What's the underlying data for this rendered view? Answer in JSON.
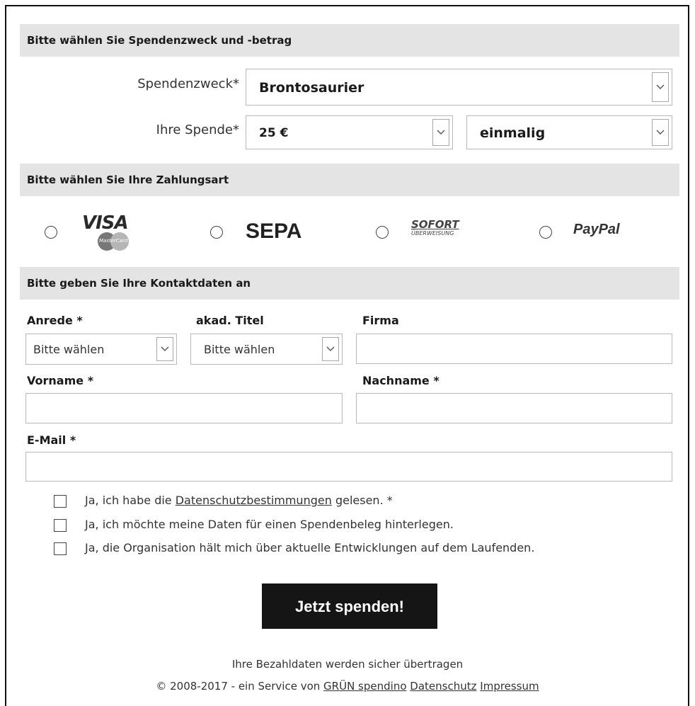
{
  "section1": {
    "title": "Bitte wählen Sie Spendenzweck und -betrag",
    "purpose_label": "Spendenzweck",
    "purpose_value": "Brontosaurier",
    "amount_label": "Ihre Spende",
    "amount_value": "25 €",
    "frequency_value": "einmalig",
    "required_mark": "*"
  },
  "section2": {
    "title": "Bitte wählen Sie Ihre Zahlungsart",
    "methods": [
      {
        "name": "VISA",
        "sub": "MasterCard",
        "icon": "visa-mastercard-logo"
      },
      {
        "name": "SEPA",
        "icon": "sepa-logo"
      },
      {
        "name": "SOFORT",
        "sub": "ÜBERWEISUNG",
        "icon": "sofort-logo"
      },
      {
        "name": "PayPal",
        "icon": "paypal-logo"
      }
    ]
  },
  "section3": {
    "title": "Bitte geben Sie Ihre Kontaktdaten an",
    "salutation_label": "Anrede",
    "salutation_value": "Bitte wählen",
    "title_label": "akad. Titel",
    "title_value": "Bitte wählen",
    "company_label": "Firma",
    "firstname_label": "Vorname",
    "lastname_label": "Nachname",
    "email_label": "E-Mail",
    "required_mark": "*"
  },
  "consents": {
    "privacy_prefix": "Ja, ich habe die",
    "privacy_link": "Datenschutzbestimmungen",
    "privacy_suffix": "gelesen. *",
    "receipt": "Ja, ich möchte meine Daten für einen Spendenbeleg hinterlegen.",
    "updates": "Ja, die Organisation hält mich über aktuelle Entwicklungen auf dem Laufenden."
  },
  "submit_label": "Jetzt spenden!",
  "footer": {
    "secure_text": "Ihre Bezahldaten werden sicher übertragen",
    "copyright": "© 2008-2017 - ein Service von",
    "brand_link": "GRÜN spendino",
    "privacy_link": "Datenschutz",
    "imprint_link": "Impressum"
  },
  "colors": {
    "section_bg": "#e4e4e4",
    "button_bg": "#151515",
    "border": "#b9b9b9"
  }
}
